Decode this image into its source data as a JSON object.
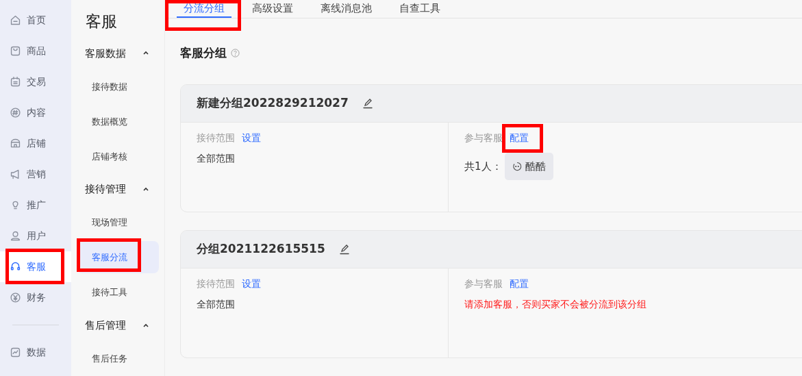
{
  "nav": {
    "items": [
      {
        "label": "首页",
        "selected": false,
        "highlighted": false
      },
      {
        "label": "商品",
        "selected": false,
        "highlighted": false
      },
      {
        "label": "交易",
        "selected": false,
        "highlighted": false
      },
      {
        "label": "内容",
        "selected": false,
        "highlighted": false
      },
      {
        "label": "店铺",
        "selected": false,
        "highlighted": false
      },
      {
        "label": "营销",
        "selected": false,
        "highlighted": false
      },
      {
        "label": "推广",
        "selected": false,
        "highlighted": false
      },
      {
        "label": "用户",
        "selected": false,
        "highlighted": false
      },
      {
        "label": "客服",
        "selected": true,
        "highlighted": true
      },
      {
        "label": "财务",
        "selected": false,
        "highlighted": false
      },
      {
        "kind": "divider"
      },
      {
        "label": "数据",
        "selected": false,
        "highlighted": false
      }
    ]
  },
  "subnav": {
    "title": "客服",
    "groups": [
      {
        "label": "客服数据",
        "expanded": true,
        "items": [
          {
            "label": "接待数据",
            "selected": false,
            "highlighted": false
          },
          {
            "label": "数据概览",
            "selected": false,
            "highlighted": false
          },
          {
            "label": "店铺考核",
            "selected": false,
            "highlighted": false
          }
        ]
      },
      {
        "label": "接待管理",
        "expanded": true,
        "items": [
          {
            "label": "现场管理",
            "selected": false,
            "highlighted": false
          },
          {
            "label": "客服分流",
            "selected": true,
            "highlighted": true
          },
          {
            "label": "接待工具",
            "selected": false,
            "highlighted": false
          }
        ]
      },
      {
        "label": "售后管理",
        "expanded": true,
        "items": [
          {
            "label": "售后任务",
            "selected": false,
            "highlighted": false
          }
        ]
      }
    ]
  },
  "tabs": [
    {
      "label": "分流分组",
      "selected": true,
      "highlighted": true
    },
    {
      "label": "高级设置",
      "selected": false,
      "highlighted": false
    },
    {
      "label": "离线消息池",
      "selected": false,
      "highlighted": false
    },
    {
      "label": "自查工具",
      "selected": false,
      "highlighted": false
    }
  ],
  "section_title": "客服分组",
  "groups": [
    {
      "name": "新建分组2022829212027",
      "scope_label": "接待范围",
      "scope_link": "设置",
      "scope_value": "全部范围",
      "agents_label": "参与客服",
      "agents_link": "配置",
      "agents_link_highlighted": true,
      "agents_count": "共1人：",
      "agents": [
        "酷酷"
      ]
    },
    {
      "name": "分组2021122615515",
      "scope_label": "接待范围",
      "scope_link": "设置",
      "scope_value": "全部范围",
      "agents_label": "参与客服",
      "agents_link": "配置",
      "agents_link_highlighted": false,
      "warning": "请添加客服，否则买家不会被分流到该分组"
    }
  ]
}
